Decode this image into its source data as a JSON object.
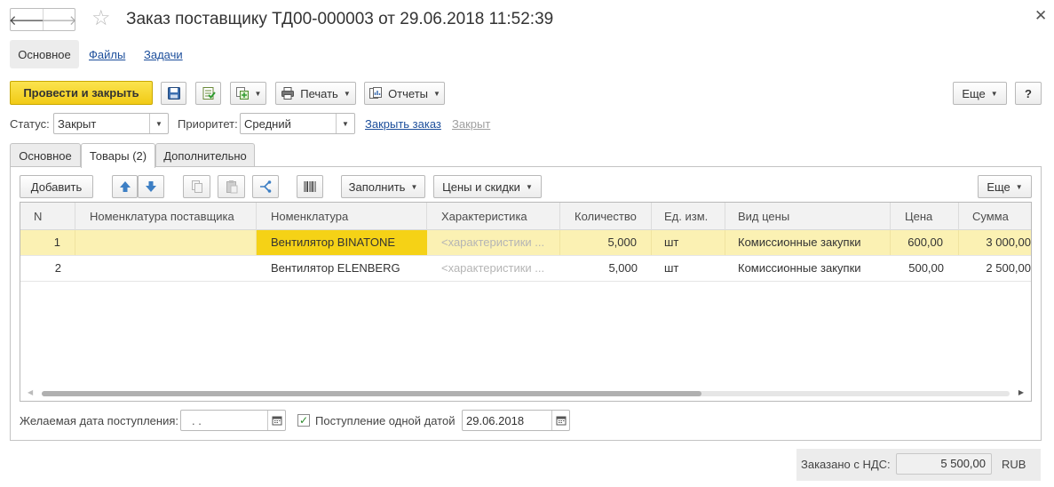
{
  "window": {
    "title": "Заказ поставщику ТД00-000003 от 29.06.2018 11:52:39",
    "back_icon": "arrow-left",
    "forward_icon": "arrow-right",
    "favorite_icon": "star",
    "close_icon": "close"
  },
  "sections": {
    "active": "Основное",
    "files": "Файлы",
    "tasks": "Задачи"
  },
  "toolbar": {
    "post_close": "Провести и закрыть",
    "print": "Печать",
    "reports": "Отчеты",
    "more": "Еще",
    "help": "?"
  },
  "status_line": {
    "status_label": "Статус:",
    "status_value": "Закрыт",
    "priority_label": "Приоритет:",
    "priority_value": "Средний",
    "close_order": "Закрыть заказ",
    "closed": "Закрыт"
  },
  "tabs": {
    "main": "Основное",
    "goods": "Товары (2)",
    "additional": "Дополнительно"
  },
  "goods_toolbar": {
    "add": "Добавить",
    "fill": "Заполнить",
    "prices": "Цены и скидки",
    "more": "Еще"
  },
  "table": {
    "columns": [
      "N",
      "Номенклатура поставщика",
      "Номенклатура",
      "Характеристика",
      "Количество",
      "Ед. изм.",
      "Вид цены",
      "Цена",
      "Сумма"
    ],
    "rows": [
      {
        "n": "1",
        "supplier_item": "",
        "item": "Вентилятор BINATONE",
        "characteristic": "<характеристики ...",
        "qty": "5,000",
        "unit": "шт",
        "price_type": "Комиссионные закупки",
        "price": "600,00",
        "sum": "3 000,00"
      },
      {
        "n": "2",
        "supplier_item": "",
        "item": "Вентилятор ELENBERG",
        "characteristic": "<характеристики ...",
        "qty": "5,000",
        "unit": "шт",
        "price_type": "Комиссионные закупки",
        "price": "500,00",
        "sum": "2 500,00"
      }
    ]
  },
  "bottom": {
    "desired_date_label": "Желаемая дата поступления:",
    "desired_date_value": ".  .",
    "single_date_label": "Поступление одной датой",
    "single_date_checked": true,
    "single_date_value": "29.06.2018"
  },
  "footer": {
    "ordered_label": "Заказано с НДС:",
    "ordered_value": "5 500,00",
    "currency": "RUB"
  },
  "colors": {
    "primary_button": "#f1ca16",
    "selected_row": "#fbf1b3",
    "current_cell": "#f5d216",
    "link": "#1c4e9b"
  }
}
